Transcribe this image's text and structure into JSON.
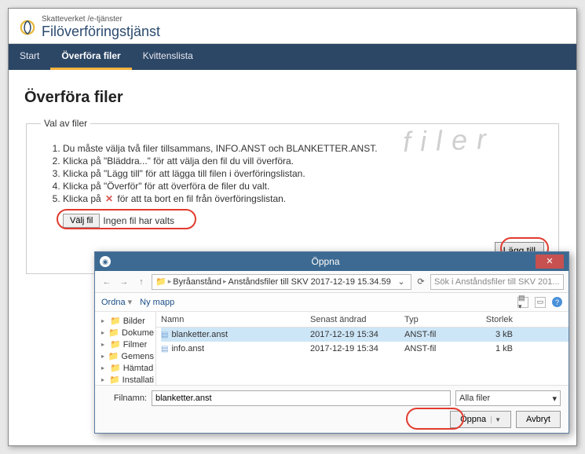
{
  "header": {
    "small_title": "Skatteverket /e-tjänster",
    "service_title": "Filöverföringstjänst"
  },
  "nav": {
    "items": [
      "Start",
      "Överföra filer",
      "Kvittenslista"
    ],
    "active_index": 1
  },
  "page": {
    "heading": "Överföra filer",
    "legend": "Val av filer",
    "watermark": "filer",
    "instructions": [
      "Du måste välja två filer tillsammans, INFO.ANST och BLANKETTER.ANST.",
      "Klicka på \"Bläddra...\" för att välja den fil du vill överföra.",
      "Klicka på \"Lägg till\" för att lägga till filen i överföringslistan.",
      "Klicka på \"Överför\" för att överföra de filer du valt.",
      "Klicka på  ✕  för att ta bort en fil från överföringslistan."
    ],
    "choose_label": "Välj fil",
    "no_file_text": "Ingen fil har valts",
    "add_label": "Lägg till"
  },
  "dialog": {
    "title": "Öppna",
    "breadcrumb": [
      "Byråanstånd",
      "Anståndsfiler till SKV 2017-12-19 15.34.59"
    ],
    "search_placeholder": "Sök i Anståndsfiler till SKV 201...",
    "toolbar": {
      "organize": "Ordna",
      "new_folder": "Ny mapp"
    },
    "tree": [
      "Bilder",
      "Dokume",
      "Filmer",
      "Gemens",
      "Hämtad",
      "Installati"
    ],
    "columns": {
      "name": "Namn",
      "date": "Senast ändrad",
      "type": "Typ",
      "size": "Storlek"
    },
    "rows": [
      {
        "name": "blanketter.anst",
        "date": "2017-12-19 15:34",
        "type": "ANST-fil",
        "size": "3 kB",
        "selected": true
      },
      {
        "name": "info.anst",
        "date": "2017-12-19 15:34",
        "type": "ANST-fil",
        "size": "1 kB",
        "selected": false
      }
    ],
    "filename_label": "Filnamn:",
    "filename_value": "blanketter.anst",
    "filter_label": "Alla filer",
    "open_label": "Öppna",
    "cancel_label": "Avbryt"
  }
}
